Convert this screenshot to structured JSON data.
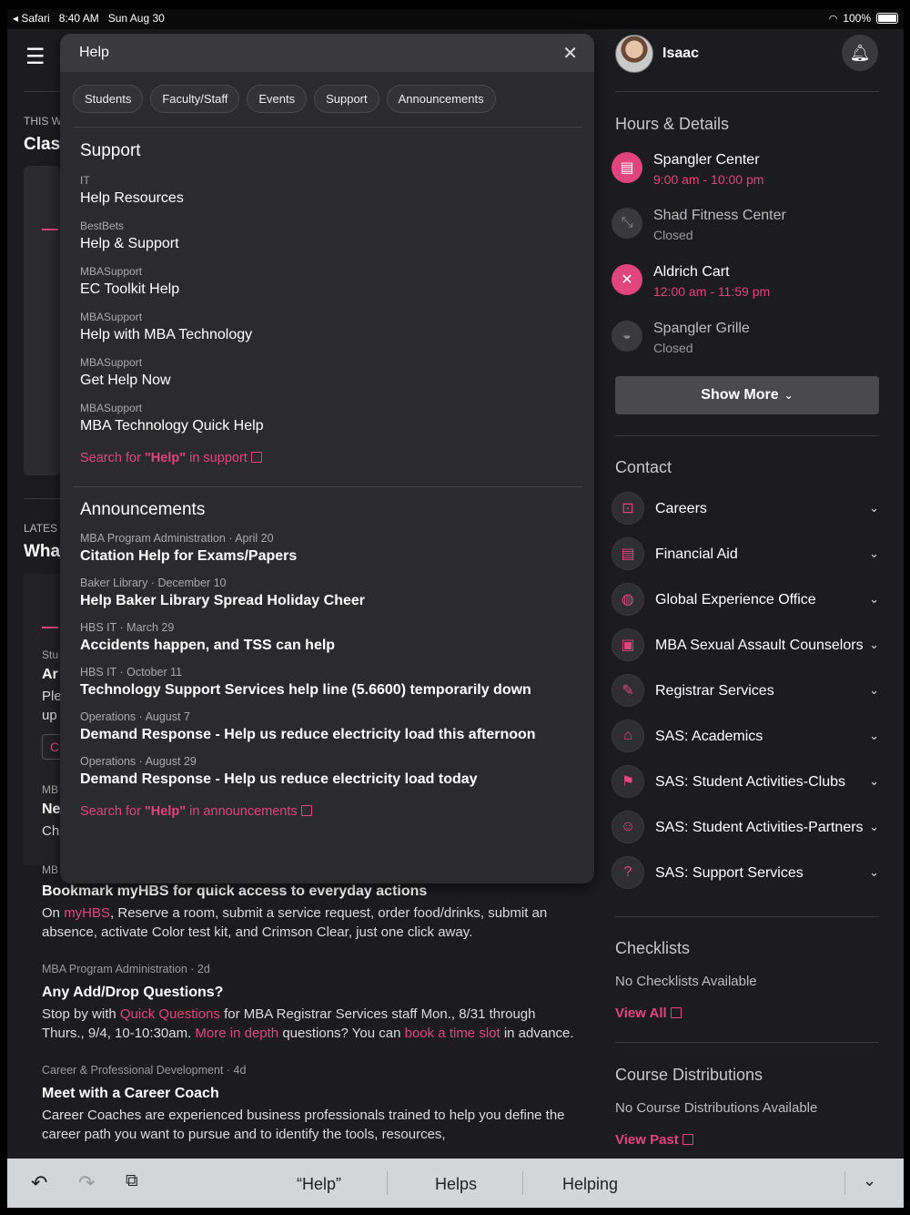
{
  "status_bar": {
    "back_app": "Safari",
    "time": "8:40 AM",
    "date": "Sun Aug 30",
    "battery": "100%"
  },
  "background": {
    "section1_label": "THIS W",
    "section1_title": "Clas",
    "section2_label": "LATES",
    "section2_title": "Wha",
    "frag": [
      "Stu",
      "Ar",
      "Ple",
      "up",
      "C",
      "MB",
      "Ne",
      "Ch",
      "MB"
    ],
    "feed": [
      {
        "meta": "",
        "title": "Bookmark myHBS for quick access to everyday actions",
        "pre": "On ",
        "link1": "myHBS",
        "body": ", Reserve a room, submit a service request, order food/drinks, submit an absence, activate Color test kit, and Crimson Clear, just one click away."
      },
      {
        "meta": "MBA Program Administration · 2d",
        "title": "Any Add/Drop Questions?",
        "pre": "Stop by with ",
        "link1": "Quick Questions",
        "mid1": " for MBA Registrar Services staff  Mon., 8/31 through Thurs., 9/4,  10-10:30am. ",
        "link2": "More in depth",
        "mid2": " questions? You can ",
        "link3": "book a time slot",
        "post": " in advance."
      },
      {
        "meta": "Career & Professional Development · 4d",
        "title": "Meet with a Career Coach",
        "body": "Career Coaches are experienced business professionals trained to help you define the career path you want to pursue and to identify the tools, resources,"
      }
    ]
  },
  "search": {
    "query": "Help",
    "chips": [
      "Students",
      "Faculty/Staff",
      "Events",
      "Support",
      "Announcements"
    ],
    "support": {
      "heading": "Support",
      "results": [
        {
          "category": "IT",
          "name": "Help Resources"
        },
        {
          "category": "BestBets",
          "name": "Help & Support"
        },
        {
          "category": "MBASupport",
          "name": "EC Toolkit Help"
        },
        {
          "category": "MBASupport",
          "name": "Help with MBA Technology"
        },
        {
          "category": "MBASupport",
          "name": "Get Help Now"
        },
        {
          "category": "MBASupport",
          "name": "MBA Technology Quick Help"
        }
      ],
      "more_pre": "Search for ",
      "more_q": "\"Help\"",
      "more_post": " in support"
    },
    "announcements": {
      "heading": "Announcements",
      "results": [
        {
          "meta": "MBA Program Administration · April 20",
          "title": "Citation Help for Exams/Papers"
        },
        {
          "meta": "Baker Library · December 10",
          "title": "Help Baker Library Spread Holiday Cheer"
        },
        {
          "meta": "HBS IT · March 29",
          "title": "Accidents happen, and TSS can help"
        },
        {
          "meta": "HBS IT · October 11",
          "title": "Technology Support Services help line (5.6600) temporarily down"
        },
        {
          "meta": "Operations · August 7",
          "title": "Demand Response - Help us reduce electricity load this afternoon"
        },
        {
          "meta": "Operations · August 29",
          "title": "Demand Response - Help us reduce electricity load today"
        }
      ],
      "more_pre": "Search for ",
      "more_q": "\"Help\"",
      "more_post": " in announcements"
    }
  },
  "user": {
    "name": "Isaac"
  },
  "hours": {
    "title": "Hours & Details",
    "locations": [
      {
        "name": "Spangler Center",
        "hours": "9:00 am - 10:00 pm",
        "open": true,
        "icon": "store-icon"
      },
      {
        "name": "Shad Fitness Center",
        "hours": "Closed",
        "open": false,
        "icon": "dumbbell-icon"
      },
      {
        "name": "Aldrich Cart",
        "hours": "12:00 am - 11:59 pm",
        "open": true,
        "icon": "utensils-icon"
      },
      {
        "name": "Spangler Grille",
        "hours": "Closed",
        "open": false,
        "icon": "food-cover-icon"
      }
    ],
    "show_more": "Show More"
  },
  "contact": {
    "title": "Contact",
    "items": [
      {
        "label": "Careers",
        "icon": "briefcase-icon"
      },
      {
        "label": "Financial Aid",
        "icon": "document-icon"
      },
      {
        "label": "Global Experience Office",
        "icon": "globe-icon"
      },
      {
        "label": "MBA Sexual Assault Counselors",
        "icon": "contact-card-icon"
      },
      {
        "label": "Registrar Services",
        "icon": "register-icon"
      },
      {
        "label": "SAS: Academics",
        "icon": "institution-icon"
      },
      {
        "label": "SAS: Student Activities-Clubs",
        "icon": "running-icon"
      },
      {
        "label": "SAS: Student Activities-Partners",
        "icon": "people-icon"
      },
      {
        "label": "SAS: Support Services",
        "icon": "help-circle-icon"
      }
    ]
  },
  "checklists": {
    "title": "Checklists",
    "empty": "No Checklists Available",
    "link": "View All"
  },
  "course": {
    "title": "Course Distributions",
    "empty": "No Course Distributions Available",
    "link": "View Past"
  },
  "keyboard": {
    "suggestions": [
      "“Help”",
      "Helps",
      "Helping"
    ]
  },
  "colors": {
    "accent": "#e0457b",
    "background": "#1c1c1e",
    "panel": "#2b2b2d"
  }
}
